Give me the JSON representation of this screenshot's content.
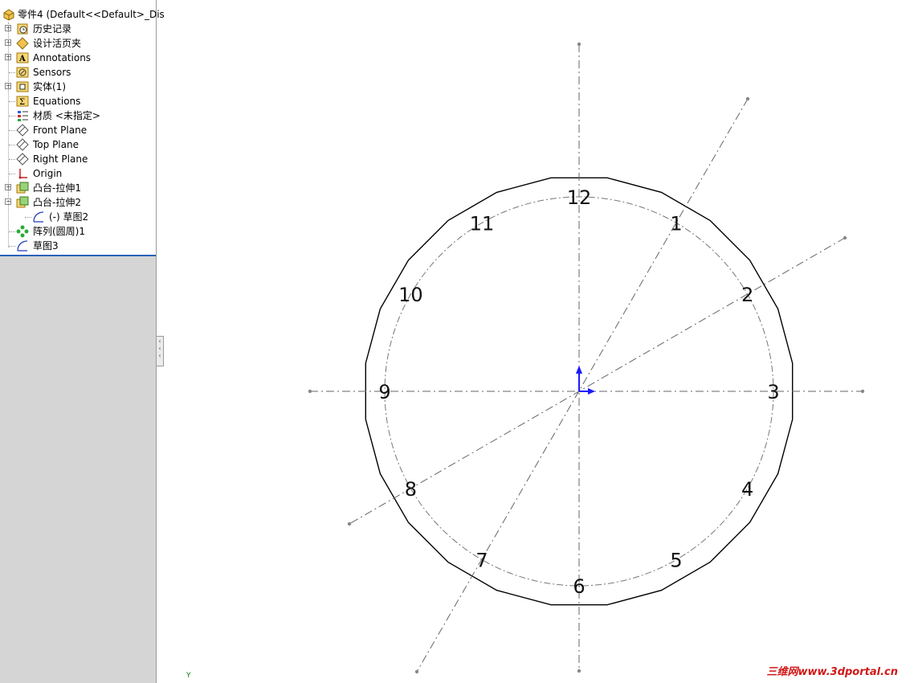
{
  "feature_tree": {
    "root_label": "零件4 (Default<<Default>_Dis",
    "items": [
      {
        "label": "历史记录",
        "icon": "history-icon",
        "expandable": true,
        "expanded": false
      },
      {
        "label": "设计活页夹",
        "icon": "design-binder-icon",
        "expandable": true,
        "expanded": false
      },
      {
        "label": "Annotations",
        "icon": "annotations-icon",
        "expandable": true,
        "expanded": false
      },
      {
        "label": "Sensors",
        "icon": "sensors-icon",
        "expandable": false
      },
      {
        "label": "实体(1)",
        "icon": "solid-bodies-icon",
        "expandable": true,
        "expanded": false
      },
      {
        "label": "Equations",
        "icon": "equations-icon",
        "expandable": false
      },
      {
        "label": "材质 <未指定>",
        "icon": "material-icon",
        "expandable": false
      },
      {
        "label": "Front Plane",
        "icon": "plane-icon",
        "expandable": false
      },
      {
        "label": "Top Plane",
        "icon": "plane-icon",
        "expandable": false
      },
      {
        "label": "Right Plane",
        "icon": "plane-icon",
        "expandable": false
      },
      {
        "label": "Origin",
        "icon": "origin-icon",
        "expandable": false
      },
      {
        "label": "凸台-拉伸1",
        "icon": "boss-extrude-icon",
        "expandable": true,
        "expanded": false
      },
      {
        "label": "凸台-拉伸2",
        "icon": "boss-extrude-icon",
        "expandable": true,
        "expanded": true
      },
      {
        "label": "(-) 草图2",
        "icon": "sketch-icon",
        "expandable": false,
        "child": true
      },
      {
        "label": "阵列(圆周)1",
        "icon": "circular-pattern-icon",
        "expandable": false
      },
      {
        "label": "草图3",
        "icon": "sketch-icon",
        "expandable": false
      }
    ]
  },
  "viewport": {
    "clock_numbers": [
      "12",
      "1",
      "2",
      "3",
      "4",
      "5",
      "6",
      "7",
      "8",
      "9",
      "10",
      "11"
    ],
    "axis_label_y": "Y",
    "watermark": "三维网www.3dportal.cn",
    "colors": {
      "outline": "#000000",
      "centerline": "#666666",
      "axis_x": "#1a1aff",
      "axis_y": "#1a1aff",
      "watermark": "#d01818"
    }
  }
}
